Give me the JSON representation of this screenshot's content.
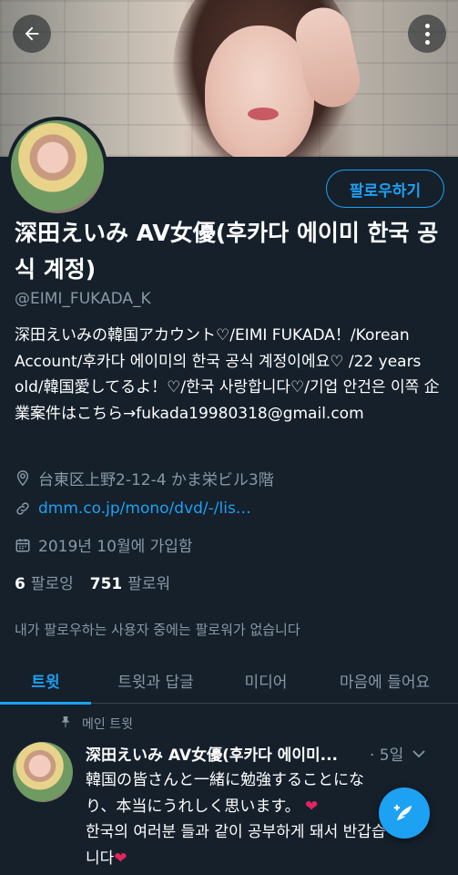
{
  "profile": {
    "name": "深田えいみ AV女優(후카다 에이미 한국 공식 계정)",
    "handle": "@EIMI_FUKADA_K",
    "bio": "深田えいみの韓国アカウント♡/EIMI FUKADA！/Korean  Account/후카다 에이미의 한국 공식 계정이에요♡ /22 years old/韓国愛してるよ！♡/한국 사랑합니다♡/기업 안건은 이쪽 企業案件はこちら→fukada19980318@gmail.com",
    "location": "台東区上野2-12-4 かま栄ビル3階",
    "link": "dmm.co.jp/mono/dvd/-/lis…",
    "joined": "2019년 10월에 가입함",
    "following_count": "6",
    "following_label": "팔로잉",
    "followers_count": "751",
    "followers_label": "팔로워",
    "no_followers_text": "내가 팔로우하는 사용자 중에는 팔로워가 없습니다"
  },
  "actions": {
    "follow_label": "팔로우하기"
  },
  "tabs": [
    {
      "label": "트윗",
      "active": true
    },
    {
      "label": "트윗과 답글",
      "active": false
    },
    {
      "label": "미디어",
      "active": false
    },
    {
      "label": "마음에 들어요",
      "active": false
    }
  ],
  "pinned_tweet": {
    "pinned_label": "메인 트윗",
    "author_name": "深田えいみ AV女優(후카다 에이미...",
    "time": "· 5일",
    "line1": "韓国の皆さんと一緒に勉強することになり、本当にうれしく思います。",
    "line2": "한국의 여러분 들과 같이 공부하게 돼서 반갑습니다"
  },
  "colors": {
    "background": "#15202b",
    "accent": "#1da1f2",
    "secondary_text": "#8899a6",
    "heart": "#e0245e"
  },
  "icons": {
    "back": "arrow-left-icon",
    "more": "more-vertical-icon",
    "location": "location-pin-icon",
    "link": "link-icon",
    "joined": "calendar-icon",
    "pin": "pin-icon",
    "caret": "chevron-down-icon",
    "compose": "compose-tweet-icon"
  }
}
